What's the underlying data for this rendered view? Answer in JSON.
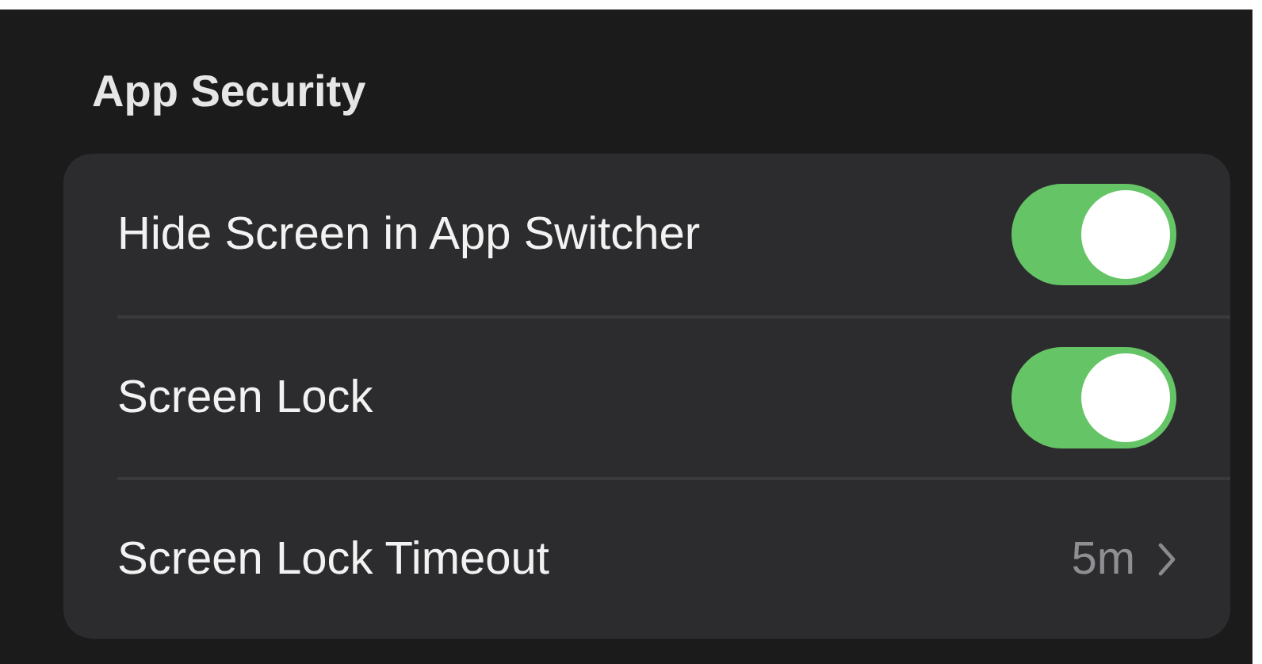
{
  "section": {
    "title": "App Security"
  },
  "rows": [
    {
      "kind": "toggle",
      "label": "Hide Screen in App Switcher",
      "on": true
    },
    {
      "kind": "toggle",
      "label": "Screen Lock",
      "on": true
    },
    {
      "kind": "value",
      "label": "Screen Lock Timeout",
      "value": "5m"
    }
  ]
}
